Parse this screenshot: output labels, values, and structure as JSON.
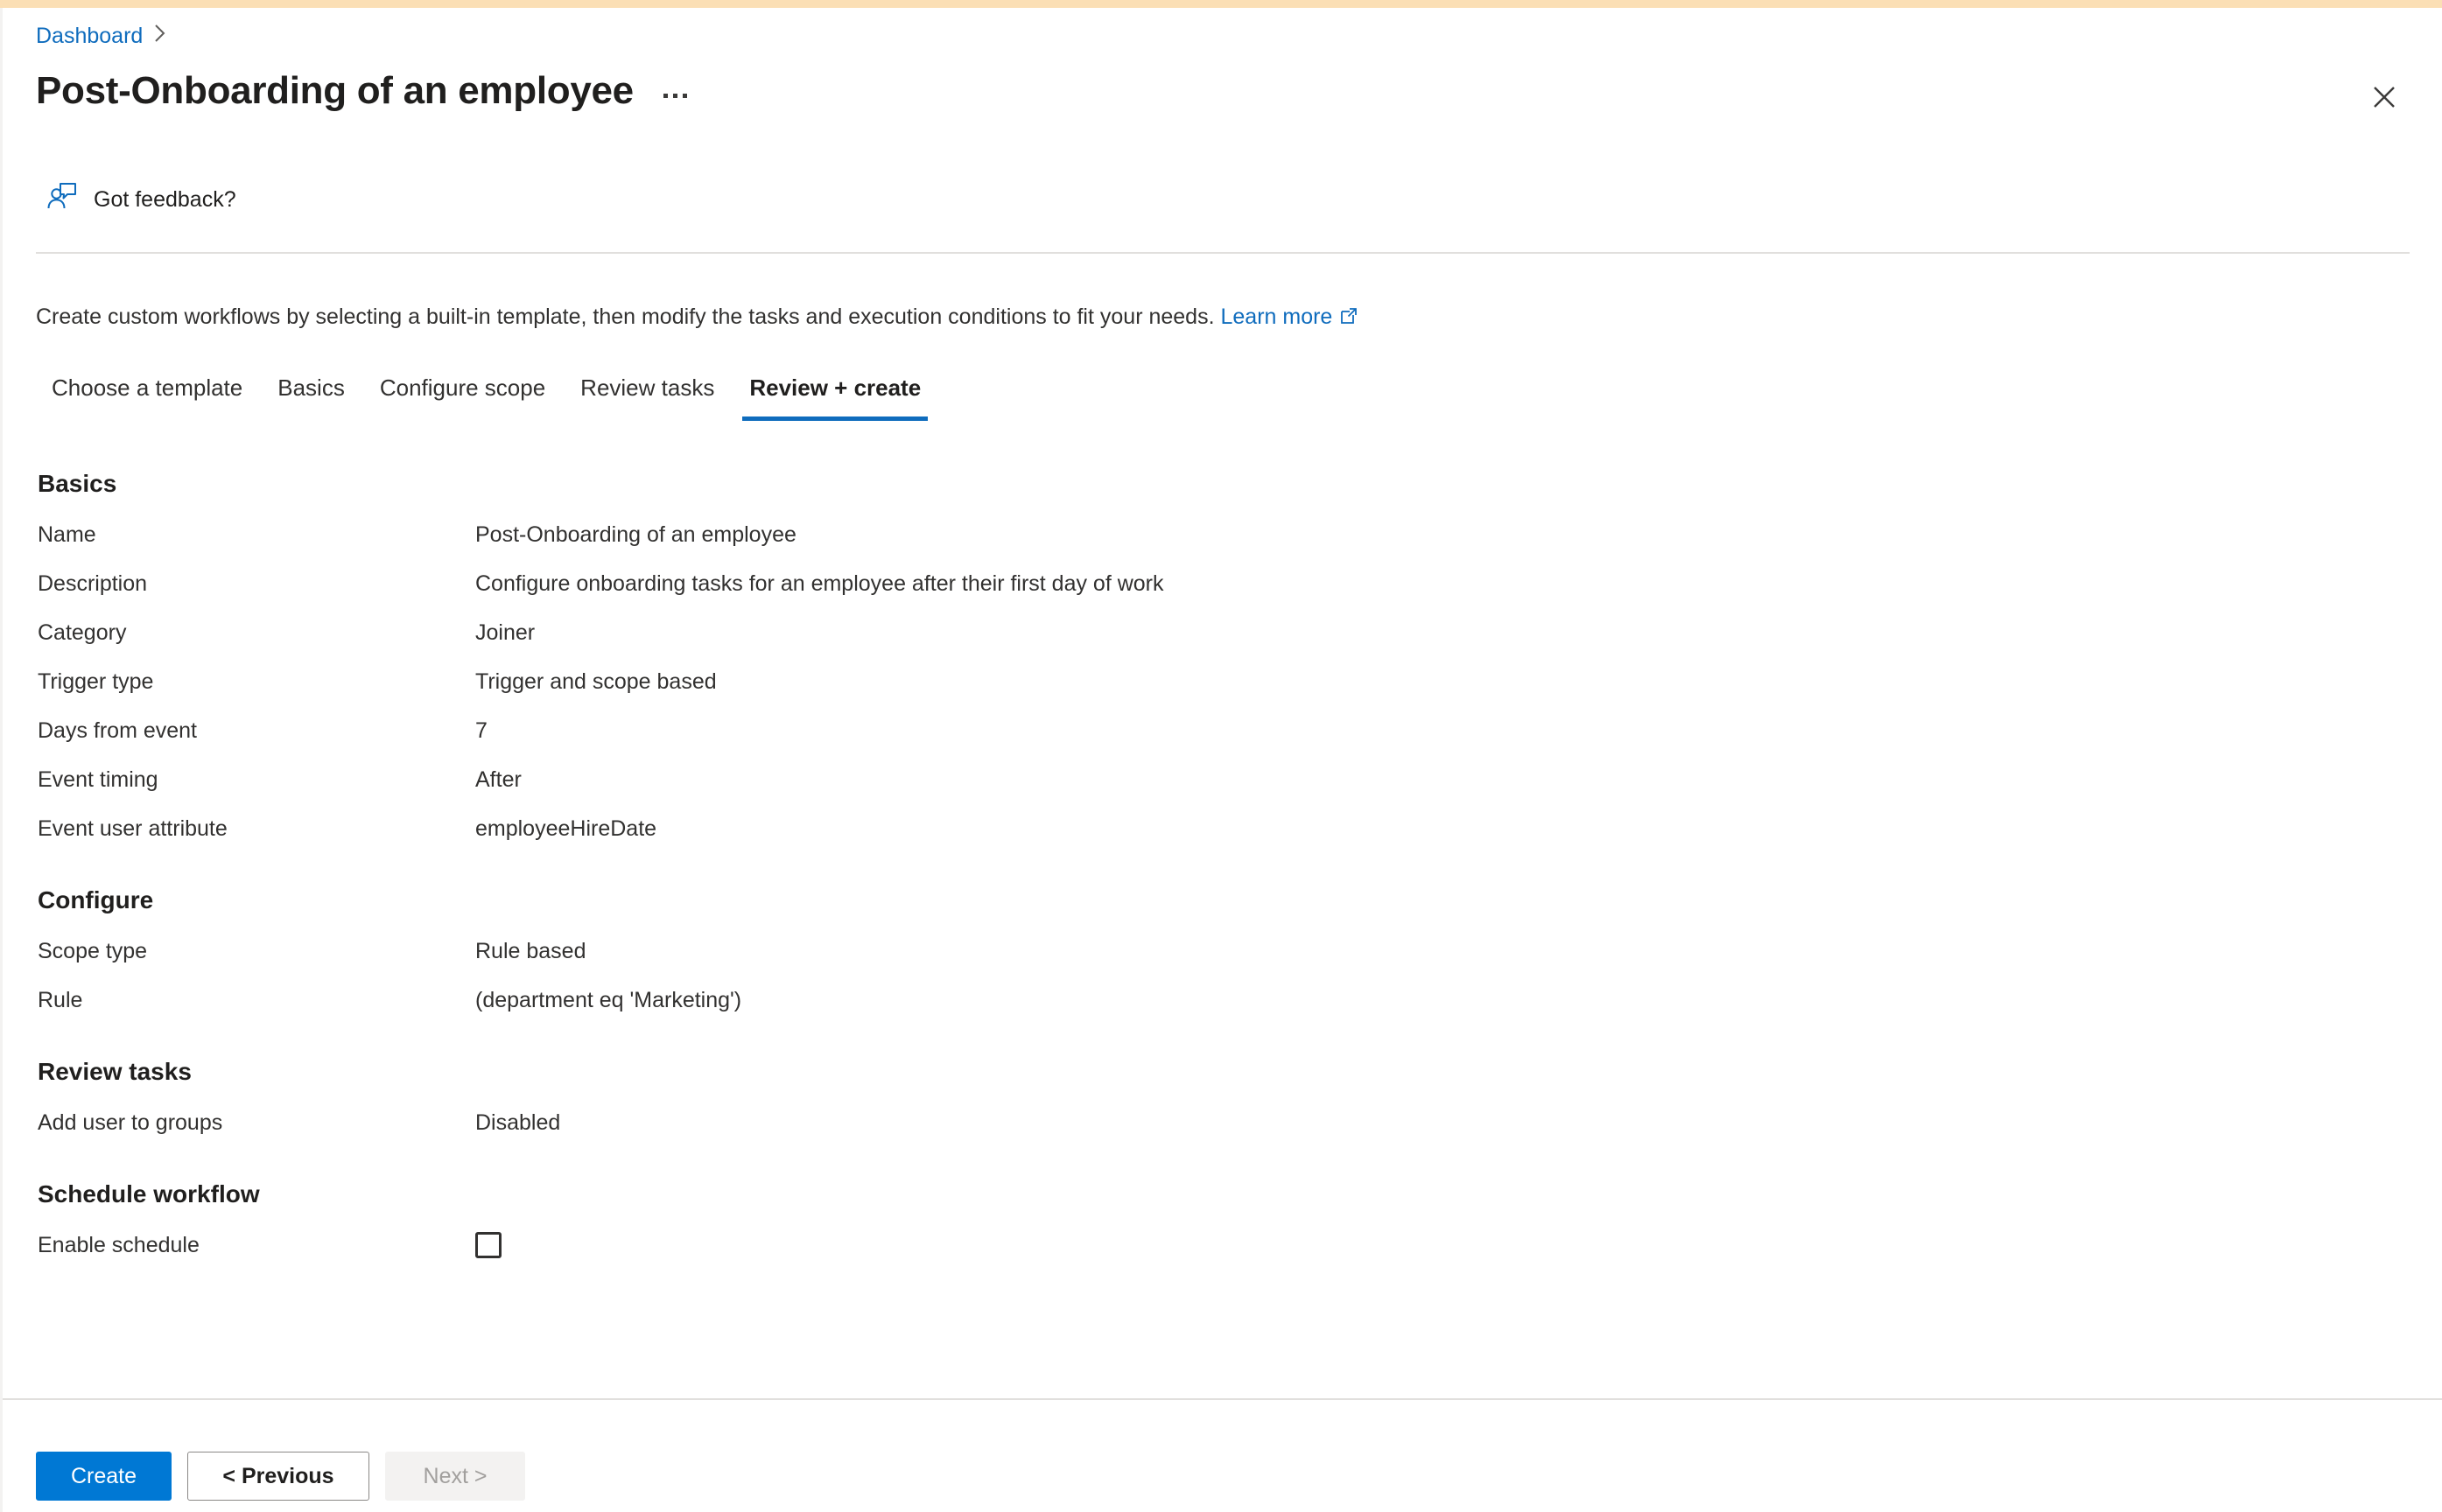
{
  "breadcrumb": {
    "items": [
      {
        "label": "Dashboard"
      }
    ],
    "separator": "›"
  },
  "header": {
    "title": "Post-Onboarding of an employee",
    "more_menu_label": "…",
    "close_label": "Close",
    "feedback_label": "Got feedback?",
    "feedback_icon": "feedback-person-icon"
  },
  "description": {
    "text": "Create custom workflows by selecting a built-in template, then modify the tasks and execution conditions to fit your needs.",
    "link_label": "Learn more",
    "link_icon": "external-link-icon"
  },
  "tabs": [
    {
      "label": "Choose a template",
      "active": false
    },
    {
      "label": "Basics",
      "active": false
    },
    {
      "label": "Configure scope",
      "active": false
    },
    {
      "label": "Review tasks",
      "active": false
    },
    {
      "label": "Review + create",
      "active": true
    }
  ],
  "sections": {
    "basics": {
      "title": "Basics",
      "rows": [
        {
          "label": "Name",
          "value": "Post-Onboarding of an employee"
        },
        {
          "label": "Description",
          "value": "Configure onboarding tasks for an employee after their first day of work"
        },
        {
          "label": "Category",
          "value": "Joiner"
        },
        {
          "label": "Trigger type",
          "value": "Trigger and scope based"
        },
        {
          "label": "Days from event",
          "value": "7"
        },
        {
          "label": "Event timing",
          "value": "After"
        },
        {
          "label": "Event user attribute",
          "value": "employeeHireDate"
        }
      ]
    },
    "configure": {
      "title": "Configure",
      "rows": [
        {
          "label": "Scope type",
          "value": "Rule based"
        },
        {
          "label": "Rule",
          "value": "(department eq 'Marketing')"
        }
      ]
    },
    "review_tasks": {
      "title": "Review tasks",
      "rows": [
        {
          "label": "Add user to groups",
          "value": "Disabled"
        }
      ]
    },
    "schedule_workflow": {
      "title": "Schedule workflow",
      "checkbox_label": "Enable schedule",
      "checkbox_checked": false
    }
  },
  "footer": {
    "create_label": "Create",
    "previous_label": "< Previous",
    "next_label": "Next >"
  },
  "colors": {
    "accent_top_bar": "#fbdfb5",
    "link": "#0f6cbd",
    "primary_button": "#0078d4",
    "tab_underline": "#0f6cbd",
    "divider": "#e1dfdd",
    "text": "#323130"
  }
}
